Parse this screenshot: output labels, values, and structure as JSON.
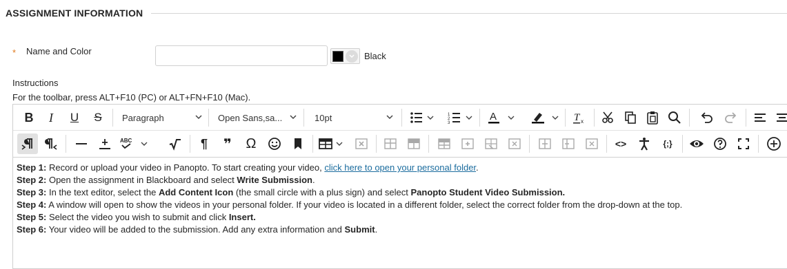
{
  "section": {
    "title": "ASSIGNMENT INFORMATION"
  },
  "name_field": {
    "required_marker": "*",
    "label": "Name and Color",
    "value": "",
    "placeholder": "",
    "color_name": "Black",
    "color_value": "#000000"
  },
  "instructions": {
    "label": "Instructions",
    "toolbar_hint": "For the toolbar, press ALT+F10 (PC) or ALT+FN+F10 (Mac)."
  },
  "toolbar": {
    "bold": "B",
    "italic": "I",
    "underline": "U",
    "strike": "S",
    "paragraph_format": "Paragraph",
    "font_family": "Open Sans,sa...",
    "font_size": "10pt",
    "spellcheck_abbr": "ABC",
    "pilcrow": "¶",
    "quote": "❞",
    "omega": "Ω",
    "code": "<>",
    "var": "{;}"
  },
  "steps": [
    {
      "label": "Step 1:",
      "text": " Record or upload your video in Panopto. To start creating your video, ",
      "link": "click here to open your personal folder",
      "after": "."
    },
    {
      "label": "Step 2:",
      "text": " Open the assignment in Blackboard and select ",
      "bold": "Write Submission",
      "after": "."
    },
    {
      "label": "Step 3:",
      "text": " In the text editor, select the ",
      "bold": "Add Content Icon",
      "mid": " (the small circle with a plus sign) and select ",
      "bold2": "Panopto Student Video Submission."
    },
    {
      "label": "Step 4:",
      "text": " A window will open to show the videos in your personal folder. If your video is located in a different folder, select the correct folder from the drop-down at the top."
    },
    {
      "label": "Step 5:",
      "text": " Select the video you wish to submit and click ",
      "bold": "Insert."
    },
    {
      "label": "Step 6:",
      "text": " Your video will be added to the submission. Add any extra information and ",
      "bold": "Submit",
      "after": "."
    }
  ]
}
